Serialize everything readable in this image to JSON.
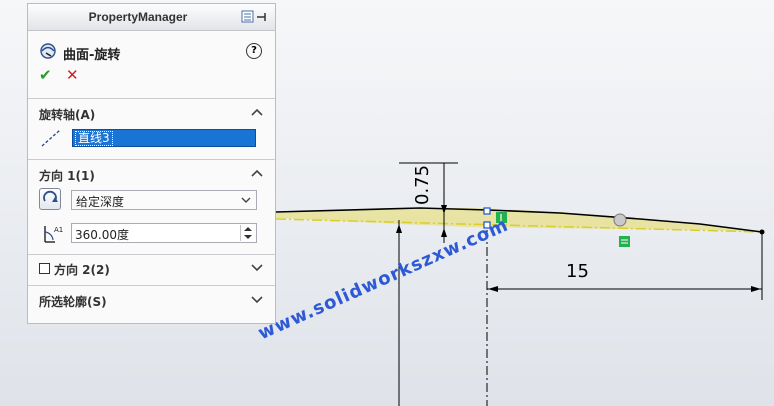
{
  "property_manager": {
    "title": "PropertyManager",
    "feature_name": "曲面-旋转",
    "help_label": "?",
    "ok_label": "✔",
    "cancel_label": "✕",
    "sections": {
      "rotation_axis": {
        "title": "旋转轴(A)",
        "value": "直线3"
      },
      "direction1": {
        "title": "方向 1(1)",
        "end_condition": "给定深度",
        "angle": "360.00度"
      },
      "direction2": {
        "title": "方向 2(2)",
        "checked": false
      },
      "selected_contours": {
        "title": "所选轮廓(S)"
      }
    }
  },
  "graphics": {
    "dimension_vertical": "0.75",
    "dimension_horizontal": "15",
    "profile_color": "#e8e29a",
    "dimension_color": "#000000",
    "relation_color": "#22b14c"
  },
  "watermark": "www.solidworkszxw.com",
  "icons": {
    "feature": "revolve-surface-icon",
    "axis": "axis-line-icon",
    "reverse": "reverse-direction-icon",
    "angle": "angle-icon"
  }
}
